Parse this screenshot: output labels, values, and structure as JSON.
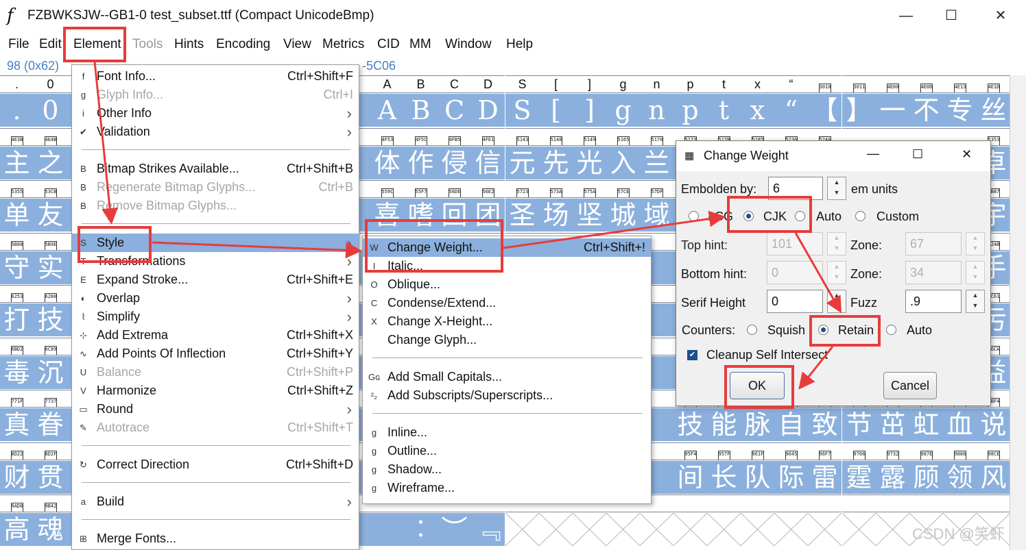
{
  "window": {
    "title": "FZBWKSJW--GB1-0  test_subset.ttf (Compact UnicodeBmp)",
    "min": "—",
    "max": "☐",
    "close": "✕"
  },
  "menubar": [
    {
      "label": "File",
      "disabled": false
    },
    {
      "label": "Edit",
      "disabled": false
    },
    {
      "label": "Element",
      "disabled": false
    },
    {
      "label": "Tools",
      "disabled": true
    },
    {
      "label": "Hints",
      "disabled": false
    },
    {
      "label": "Encoding",
      "disabled": false
    },
    {
      "label": "View",
      "disabled": false
    },
    {
      "label": "Metrics",
      "disabled": false
    },
    {
      "label": "CID",
      "disabled": false
    },
    {
      "label": "MM",
      "disabled": false
    },
    {
      "label": "Window",
      "disabled": false
    },
    {
      "label": "Help",
      "disabled": false
    }
  ],
  "infobar": {
    "left": "98 (0x62)",
    "right": "-5C06"
  },
  "grid": {
    "rows": [
      {
        "labels": [
          ".",
          "0",
          "",
          "",
          "",
          "",
          "",
          "",
          "",
          "",
          "",
          "A",
          "B",
          "C",
          "D",
          "S",
          "[",
          "]",
          "g",
          "n",
          "p",
          "t",
          "x",
          "“",
          "3010",
          "3011",
          "4E00",
          "4E0D",
          "4E13",
          "4E1D"
        ],
        "glyphs": [
          ".",
          "0",
          "",
          "",
          "",
          "",
          "",
          "",
          "",
          "",
          "",
          "A",
          "B",
          "C",
          "D",
          "S",
          "[",
          "]",
          "g",
          "n",
          "p",
          "t",
          "x",
          "“",
          "【",
          "】",
          "一",
          "不",
          "专",
          "丝"
        ]
      },
      {
        "labels": [
          "4E3B",
          "4E4B",
          "",
          "",
          "",
          "",
          "",
          "",
          "",
          "",
          "",
          "4F53",
          "4F5C",
          "4FB5",
          "4FE1",
          "5143",
          "5148",
          "5149",
          "5165",
          "5170",
          "5173",
          "517B",
          "5185",
          "5236",
          "524A",
          "",
          "",
          "",
          "",
          "5353"
        ],
        "glyphs": [
          "主",
          "之",
          "",
          "",
          "",
          "",
          "",
          "",
          "",
          "",
          "",
          "体",
          "作",
          "侵",
          "信",
          "元",
          "先",
          "光",
          "入",
          "兰",
          "",
          "",
          "",
          "",
          "",
          "",
          "",
          "",
          "",
          "卓"
        ]
      },
      {
        "labels": [
          "5355",
          "53CB",
          "",
          "",
          "",
          "",
          "",
          "",
          "",
          "",
          "",
          "559C",
          "55F7",
          "56DE",
          "56E2",
          "5723",
          "573A",
          "575A",
          "57CE",
          "57DF",
          "",
          "",
          "",
          "",
          "",
          "",
          "",
          "",
          "",
          "5B87"
        ],
        "glyphs": [
          "单",
          "友",
          "",
          "",
          "",
          "",
          "",
          "",
          "",
          "",
          "",
          "喜",
          "嗜",
          "回",
          "团",
          "圣",
          "场",
          "坚",
          "城",
          "域",
          "",
          "",
          "",
          "",
          "",
          "",
          "",
          "",
          "",
          "宇"
        ]
      },
      {
        "labels": [
          "5B88",
          "5B9E",
          "",
          "",
          "",
          "",
          "",
          "",
          "",
          "",
          "",
          "",
          "",
          "",
          "",
          "",
          "",
          "",
          "",
          "",
          "",
          "",
          "",
          "",
          "",
          "",
          "",
          "",
          "",
          "624B"
        ],
        "glyphs": [
          "守",
          "实",
          "",
          "",
          "",
          "",
          "",
          "",
          "",
          "",
          "",
          "",
          "",
          "",
          "",
          "",
          "",
          "",
          "",
          "",
          "",
          "",
          "",
          "",
          "",
          "",
          "",
          "",
          "",
          "手"
        ]
      },
      {
        "labels": [
          "6253",
          "6280",
          "",
          "",
          "",
          "",
          "",
          "",
          "",
          "",
          "",
          "",
          "",
          "",
          "",
          "",
          "",
          "",
          "",
          "",
          "",
          "",
          "",
          "",
          "",
          "",
          "",
          "",
          "",
          "6C61"
        ],
        "glyphs": [
          "打",
          "技",
          "",
          "",
          "",
          "",
          "",
          "",
          "",
          "",
          "",
          "",
          "",
          "",
          "",
          "",
          "",
          "",
          "",
          "",
          "",
          "",
          "",
          "",
          "",
          "",
          "",
          "",
          "",
          "污"
        ]
      },
      {
        "labels": [
          "6BD2",
          "6C89",
          "",
          "",
          "",
          "",
          "",
          "",
          "",
          "",
          "",
          "",
          "",
          "",
          "",
          "",
          "",
          "",
          "",
          "",
          "",
          "",
          "",
          "",
          "",
          "",
          "",
          "",
          "",
          "76CA"
        ],
        "glyphs": [
          "毒",
          "沉",
          "",
          "",
          "",
          "",
          "",
          "",
          "",
          "",
          "",
          "",
          "",
          "",
          "",
          "",
          "",
          "",
          "",
          "",
          "",
          "",
          "",
          "",
          "",
          "",
          "",
          "",
          "",
          "益"
        ]
      },
      {
        "labels": [
          "771F",
          "7737",
          "",
          "",
          "",
          "",
          "",
          "",
          "",
          "",
          "",
          "",
          "",
          "",
          "",
          "",
          "",
          "",
          "",
          "",
          "8083",
          "80FD",
          "8109",
          "81EA",
          "81F4",
          "8282",
          "8317",
          "8679",
          "8840",
          "8BF4"
        ],
        "glyphs": [
          "真",
          "眷",
          "",
          "",
          "",
          "",
          "",
          "",
          "",
          "",
          "",
          "",
          "",
          "",
          "",
          "",
          "",
          "",
          "",
          "",
          "技",
          "能",
          "脉",
          "自",
          "致",
          "节",
          "茁",
          "虹",
          "血",
          "说"
        ]
      },
      {
        "labels": [
          "8D22",
          "8D2F",
          "",
          "",
          "",
          "",
          "",
          "",
          "",
          "",
          "",
          "",
          "",
          "",
          "",
          "",
          "",
          "",
          "",
          "",
          "95F4",
          "957F",
          "961F",
          "9645",
          "96F7",
          "9706",
          "9732",
          "987E",
          "9886",
          "98CE"
        ],
        "glyphs": [
          "财",
          "贯",
          "",
          "",
          "",
          "",
          "",
          "",
          "",
          "",
          "",
          "",
          "",
          "",
          "",
          "",
          "",
          "",
          "",
          "",
          "间",
          "长",
          "队",
          "际",
          "雷",
          "霆",
          "露",
          "顾",
          "领",
          "风"
        ]
      },
      {
        "labels": [
          "9AD8",
          "9B42",
          "",
          "",
          "",
          "",
          "",
          "",
          "",
          "",
          "",
          "",
          "",
          "",
          "",
          "",
          "",
          "",
          "",
          "",
          "",
          "",
          "",
          "",
          "",
          "",
          "",
          "",
          "",
          ""
        ],
        "glyphs": [
          "高",
          "魂",
          "",
          "",
          "",
          "",
          "",
          "",
          "",
          "",
          "",
          "",
          "︰",
          "︶",
          "﹃",
          "",
          "",
          "",
          "",
          "",
          "",
          "",
          "",
          "",
          "",
          "",
          "",
          "",
          "",
          ""
        ]
      }
    ]
  },
  "element_menu": {
    "items": [
      {
        "type": "item",
        "icon": "font-info-icon",
        "glyph": "f",
        "label": "Font Info...",
        "shortcut": "Ctrl+Shift+F",
        "disabled": false
      },
      {
        "type": "item",
        "icon": "glyph-info-icon",
        "glyph": "g",
        "label": "Glyph Info...",
        "shortcut": "Ctrl+I",
        "disabled": true
      },
      {
        "type": "item",
        "icon": "info-icon",
        "glyph": "i",
        "label": "Other Info",
        "submenu": true,
        "disabled": false
      },
      {
        "type": "item",
        "icon": "check-icon",
        "glyph": "✔",
        "label": "Validation",
        "submenu": true,
        "disabled": false
      },
      {
        "type": "sep"
      },
      {
        "type": "item",
        "icon": "bitmap-icon",
        "glyph": "B",
        "label": "Bitmap Strikes Available...",
        "shortcut": "Ctrl+Shift+B",
        "disabled": false
      },
      {
        "type": "item",
        "icon": "regen-bitmap-icon",
        "glyph": "B",
        "label": "Regenerate Bitmap Glyphs...",
        "shortcut": "Ctrl+B",
        "disabled": true
      },
      {
        "type": "item",
        "icon": "remove-bitmap-icon",
        "glyph": "B",
        "label": "Remove Bitmap Glyphs...",
        "disabled": true
      },
      {
        "type": "sep"
      },
      {
        "type": "item",
        "icon": "style-icon",
        "glyph": "S",
        "label": "Style",
        "submenu": true,
        "highlight": true,
        "disabled": false
      },
      {
        "type": "item",
        "icon": "transform-icon",
        "glyph": "T",
        "label": "Transformations",
        "submenu": true,
        "disabled": false
      },
      {
        "type": "item",
        "icon": "expand-stroke-icon",
        "glyph": "E",
        "label": "Expand Stroke...",
        "shortcut": "Ctrl+Shift+E",
        "disabled": false
      },
      {
        "type": "item",
        "icon": "overlap-icon",
        "glyph": "◐",
        "label": "Overlap",
        "submenu": true,
        "disabled": false
      },
      {
        "type": "item",
        "icon": "simplify-icon",
        "glyph": "⌇",
        "label": "Simplify",
        "submenu": true,
        "disabled": false
      },
      {
        "type": "item",
        "icon": "extrema-icon",
        "glyph": "⊹",
        "label": "Add Extrema",
        "shortcut": "Ctrl+Shift+X",
        "disabled": false
      },
      {
        "type": "item",
        "icon": "inflection-icon",
        "glyph": "∿",
        "label": "Add Points Of Inflection",
        "shortcut": "Ctrl+Shift+Y",
        "disabled": false
      },
      {
        "type": "item",
        "icon": "balance-icon",
        "glyph": "U",
        "label": "Balance",
        "shortcut": "Ctrl+Shift+P",
        "disabled": true
      },
      {
        "type": "item",
        "icon": "harmonize-icon",
        "glyph": "V",
        "label": "Harmonize",
        "shortcut": "Ctrl+Shift+Z",
        "disabled": false
      },
      {
        "type": "item",
        "icon": "round-icon",
        "glyph": "▭",
        "label": "Round",
        "submenu": true,
        "disabled": false
      },
      {
        "type": "item",
        "icon": "autotrace-icon",
        "glyph": "✎",
        "label": "Autotrace",
        "shortcut": "Ctrl+Shift+T",
        "disabled": true
      },
      {
        "type": "sep"
      },
      {
        "type": "item",
        "icon": "direction-icon",
        "glyph": "↻",
        "label": "Correct Direction",
        "shortcut": "Ctrl+Shift+D",
        "disabled": false
      },
      {
        "type": "sep"
      },
      {
        "type": "item",
        "icon": "build-icon",
        "glyph": "a",
        "label": "Build",
        "submenu": true,
        "disabled": false
      },
      {
        "type": "sep"
      },
      {
        "type": "item",
        "icon": "merge-icon",
        "glyph": "⊞",
        "label": "Merge Fonts...",
        "disabled": false
      }
    ]
  },
  "style_menu": {
    "items": [
      {
        "type": "item",
        "icon": "change-weight-icon",
        "glyph": "W",
        "label": "Change Weight...",
        "shortcut": "Ctrl+Shift+!",
        "highlight": true
      },
      {
        "type": "item",
        "icon": "italic-icon",
        "glyph": "I",
        "label": "Italic..."
      },
      {
        "type": "item",
        "icon": "oblique-icon",
        "glyph": "O",
        "label": "Oblique..."
      },
      {
        "type": "item",
        "icon": "condense-icon",
        "glyph": "C",
        "label": "Condense/Extend..."
      },
      {
        "type": "item",
        "icon": "x-height-icon",
        "glyph": "X",
        "label": "Change X-Height..."
      },
      {
        "type": "item",
        "icon": "",
        "glyph": "",
        "label": "Change Glyph..."
      },
      {
        "type": "sep"
      },
      {
        "type": "item",
        "icon": "small-caps-icon",
        "glyph": "Gɢ",
        "label": "Add Small Capitals..."
      },
      {
        "type": "item",
        "icon": "subscript-icon",
        "glyph": "²₂",
        "label": "Add Subscripts/Superscripts..."
      },
      {
        "type": "sep"
      },
      {
        "type": "item",
        "icon": "inline-icon",
        "glyph": "g",
        "label": "Inline..."
      },
      {
        "type": "item",
        "icon": "outline-icon",
        "glyph": "g",
        "label": "Outline..."
      },
      {
        "type": "item",
        "icon": "shadow-icon",
        "glyph": "g",
        "label": "Shadow..."
      },
      {
        "type": "item",
        "icon": "wireframe-icon",
        "glyph": "g",
        "label": "Wireframe..."
      }
    ]
  },
  "dialog": {
    "title": "Change Weight",
    "embolden_label": "Embolden by:",
    "embolden_value": "6",
    "em_units": "em units",
    "modes": [
      {
        "label": "LCG",
        "checked": false
      },
      {
        "label": "CJK",
        "checked": true
      },
      {
        "label": "Auto",
        "checked": false
      },
      {
        "label": "Custom",
        "checked": false
      }
    ],
    "top_hint_label": "Top hint:",
    "top_hint_value": "101",
    "top_zone_label": "Zone:",
    "top_zone_value": "67",
    "bottom_hint_label": "Bottom hint:",
    "bottom_hint_value": "0",
    "bottom_zone_label": "Zone:",
    "bottom_zone_value": "34",
    "serif_label": "Serif Height",
    "serif_value": "0",
    "fuzz_label": "Fuzz",
    "fuzz_value": ".9",
    "counters_label": "Counters:",
    "counters": [
      {
        "label": "Squish",
        "checked": false
      },
      {
        "label": "Retain",
        "checked": true
      },
      {
        "label": "Auto",
        "checked": false
      }
    ],
    "cleanup_label": "Cleanup Self Intersect",
    "cleanup_checked": true,
    "ok": "OK",
    "cancel": "Cancel"
  },
  "watermark": "CSDN @笑虾"
}
